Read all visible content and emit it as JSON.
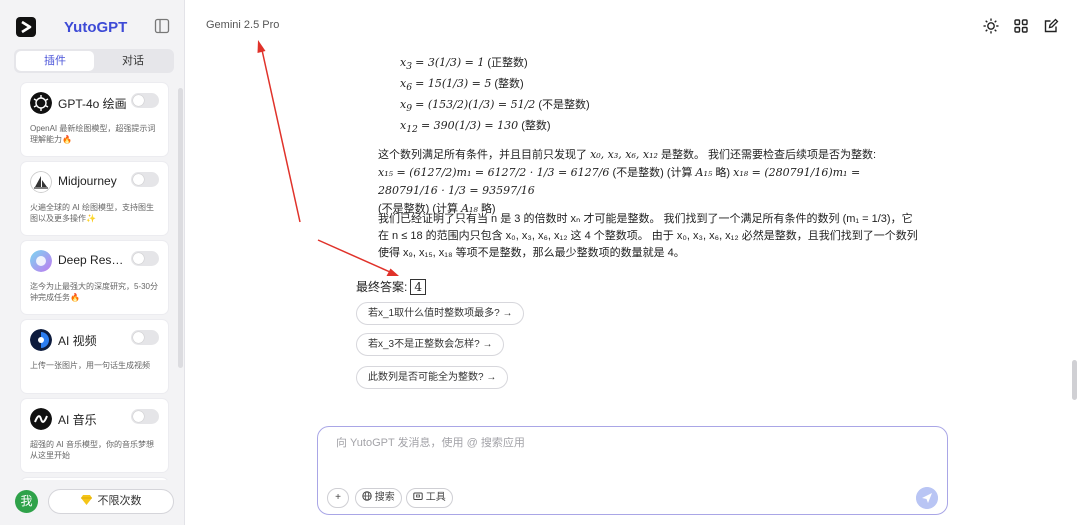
{
  "app": {
    "name": "YutoGPT",
    "model": "Gemini 2.5 Pro"
  },
  "sidebar": {
    "tabs": [
      {
        "label": "插件",
        "active": true
      },
      {
        "label": "对话",
        "active": false
      }
    ],
    "plugins": [
      {
        "name": "GPT-4o 绘画",
        "desc": "OpenAI 最新绘图模型，超强提示词理解能力",
        "badge": "🔥",
        "icon": "openai-icon",
        "enabled": false
      },
      {
        "name": "Midjourney",
        "desc": "火遍全球的 AI 绘图模型，支持图生图以及更多操作",
        "badge": "✨",
        "icon": "midjourney-icon",
        "enabled": false
      },
      {
        "name": "Deep Research",
        "desc": "迄今为止最强大的深度研究，5-30分钟完成任务",
        "badge": "🔥",
        "icon": "deep-research-icon",
        "enabled": false
      },
      {
        "name": "AI 视频",
        "desc": "上传一张图片，用一句话生成视频",
        "badge": "",
        "icon": "ai-video-icon",
        "enabled": false
      },
      {
        "name": "AI 音乐",
        "desc": "超强的 AI 音乐模型，你的音乐梦想从这里开始",
        "badge": "",
        "icon": "ai-music-icon",
        "enabled": false
      }
    ],
    "user_avatar": "我",
    "plan_label": "不限次数"
  },
  "chat": {
    "equations": [
      {
        "lhs": "x",
        "sub": "3",
        "rhs": "= 3(1/3) = 1",
        "note": "(正整数)"
      },
      {
        "lhs": "x",
        "sub": "6",
        "rhs": "= 15(1/3) = 5",
        "note": "(整数)"
      },
      {
        "lhs": "x",
        "sub": "9",
        "rhs": "= (153/2)(1/3) = 51/2",
        "note": "(不是整数)"
      },
      {
        "lhs": "x",
        "sub": "12",
        "rhs": "= 390(1/3) = 130",
        "note": "(整数)"
      }
    ],
    "para1_a": "这个数列满足所有条件，并且目前只发现了",
    "para1_b": "x₀, x₃, x₆, x₁₂",
    "para1_c": "是整数。 我们还需要检查后续项是否为整数:",
    "para1_d": "x₁₅ = (6127/2)m₁ = 6127/2 · 1/3 = 6127/6",
    "para1_e": "(不是整数) (计算",
    "para1_f": "A₁₅",
    "para1_g": "略)",
    "para1_h": "x₁₈ = (280791/16)m₁ = 280791/16 · 1/3 = 93597/16",
    "para1_i": "(不是整数) (计算",
    "para1_j": "A₁₈",
    "para1_k": "略)",
    "para2": "我们已经证明了只有当 n 是 3 的倍数时 xₙ 才可能是整数。 我们找到了一个满足所有条件的数列 (m₁ = 1/3)，它在 n ≤ 18 的范围内只包含 x₀, x₃, x₆, x₁₂ 这 4 个整数项。 由于 x₀, x₃, x₆, x₁₂ 必然是整数，且我们找到了一个数列使得 x₉, x₁₅, x₁₈ 等项不是整数，那么最少整数项的数量就是 4。",
    "final_label": "最终答案:",
    "final_value": "4",
    "suggestions": [
      "若x_1取什么值时整数项最多? →",
      "若x_3不是正整数会怎样? →",
      "此数列是否可能全为整数? →"
    ]
  },
  "input": {
    "placeholder": "向 YutoGPT 发消息，使用 @ 搜索应用",
    "plus_label": "+",
    "search_label": "搜索",
    "tools_label": "工具"
  },
  "colors": {
    "accent": "#4b55d9",
    "annotation": "#e0322a",
    "input_border": "#a9a6e6"
  }
}
